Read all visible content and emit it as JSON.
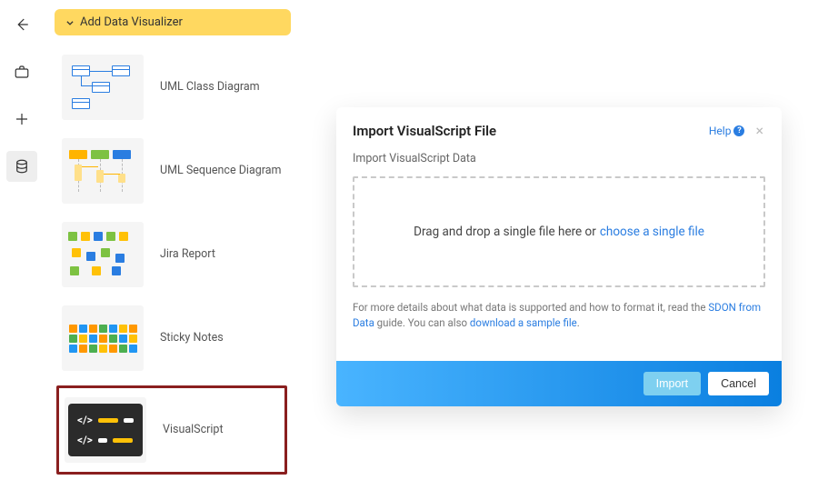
{
  "rail": {
    "back": "back",
    "toolbox": "toolbox",
    "add": "add",
    "data": "data"
  },
  "panel": {
    "title": "Add Data Visualizer",
    "items": [
      {
        "label": "UML Class Diagram",
        "kind": "uml-class"
      },
      {
        "label": "UML Sequence Diagram",
        "kind": "uml-sequence"
      },
      {
        "label": "Jira Report",
        "kind": "jira"
      },
      {
        "label": "Sticky Notes",
        "kind": "sticky"
      },
      {
        "label": "VisualScript",
        "kind": "visualscript",
        "highlight": true
      }
    ]
  },
  "modal": {
    "title": "Import VisualScript File",
    "help_label": "Help",
    "subtitle": "Import VisualScript Data",
    "drop_text": "Drag and drop a single file here or",
    "choose_link": "choose a single file",
    "details_prefix": "For more details about what data is supported and how to format it, read the ",
    "details_link1": "SDON from Data",
    "details_middle": " guide. You can also ",
    "details_link2": "download a sample file",
    "details_suffix": ".",
    "import_label": "Import",
    "cancel_label": "Cancel"
  }
}
